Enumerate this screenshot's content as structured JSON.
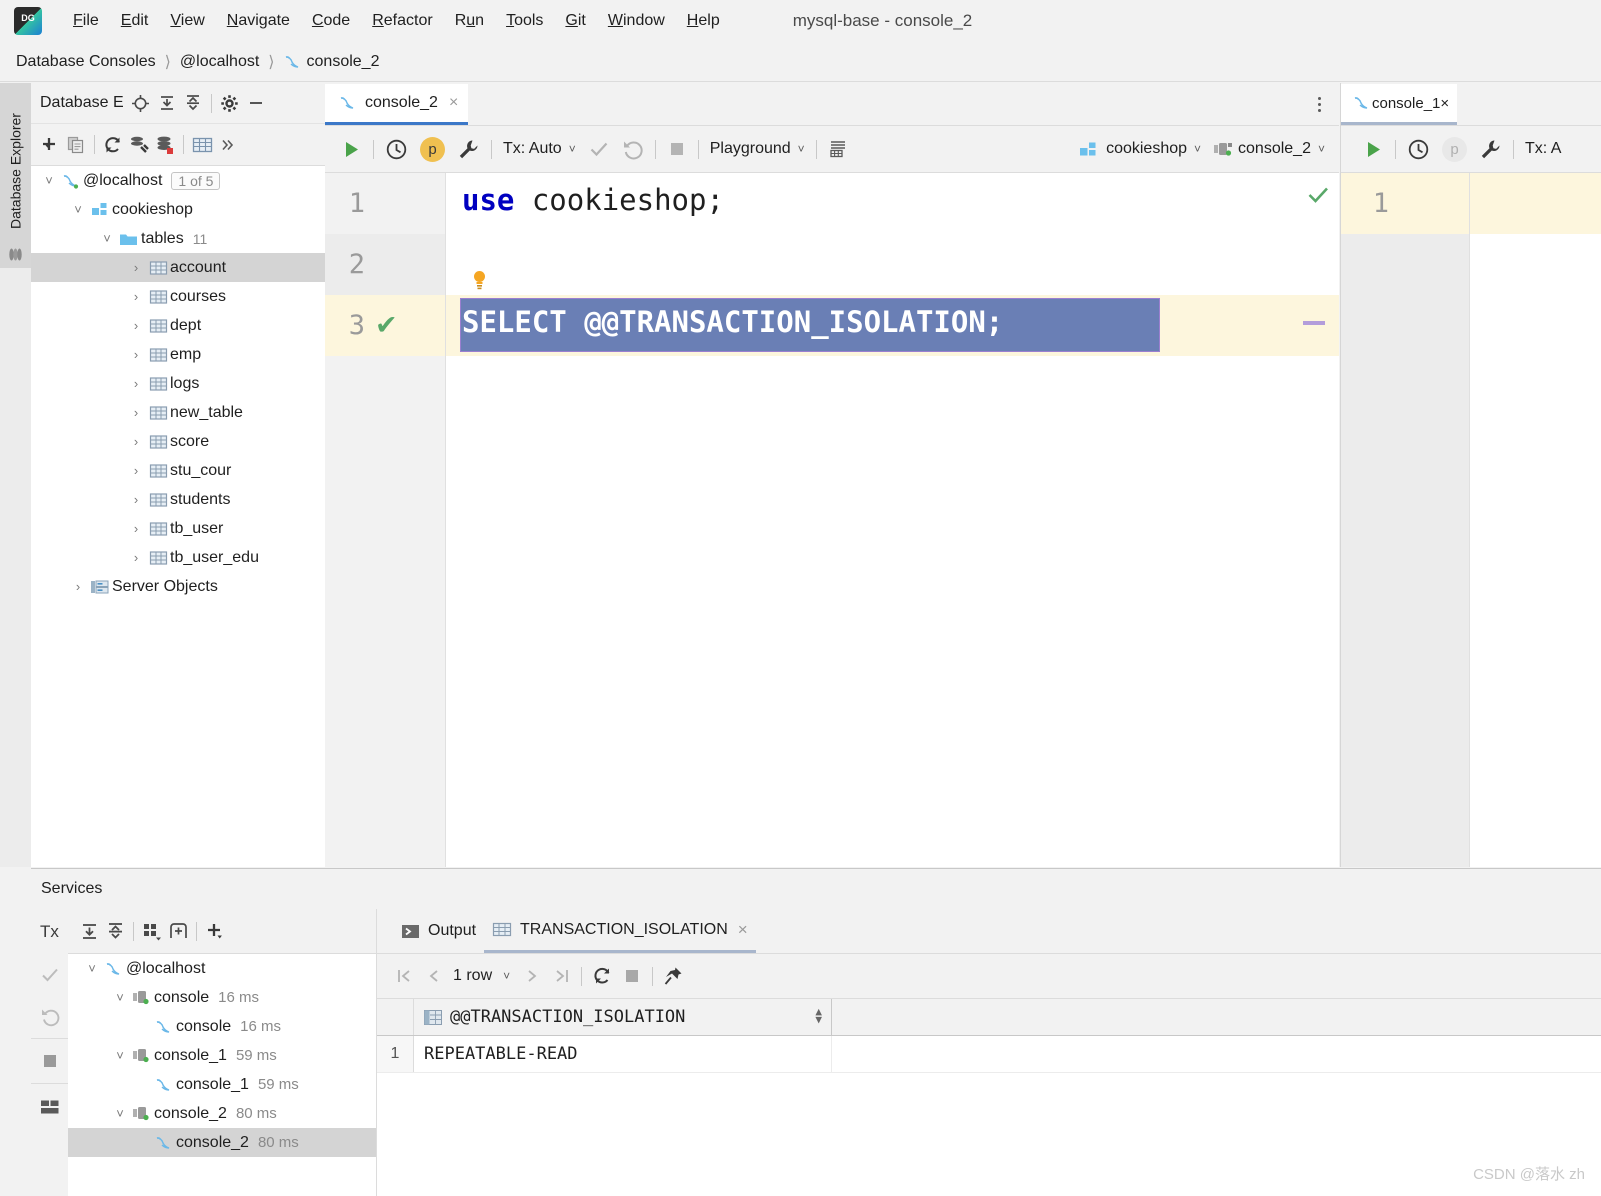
{
  "window": {
    "title": "mysql-base - console_2",
    "logo_label": "DG"
  },
  "menubar": {
    "items": [
      {
        "label": "File",
        "mnemonic": "F"
      },
      {
        "label": "Edit",
        "mnemonic": "E"
      },
      {
        "label": "View",
        "mnemonic": "V"
      },
      {
        "label": "Navigate",
        "mnemonic": "N"
      },
      {
        "label": "Code",
        "mnemonic": "C"
      },
      {
        "label": "Refactor",
        "mnemonic": "R"
      },
      {
        "label": "Run",
        "mnemonic": "u"
      },
      {
        "label": "Tools",
        "mnemonic": "T"
      },
      {
        "label": "Git",
        "mnemonic": "G"
      },
      {
        "label": "Window",
        "mnemonic": "W"
      },
      {
        "label": "Help",
        "mnemonic": "H"
      }
    ]
  },
  "breadcrumb": {
    "items": [
      "Database Consoles",
      "@localhost",
      "console_2"
    ],
    "separator": "〉"
  },
  "tool_strip": {
    "label": "Database Explorer",
    "icon": "database-stack-icon"
  },
  "db_explorer": {
    "title": "Database E",
    "header_icons": [
      "locate-icon",
      "expand-all-icon",
      "collapse-all-icon",
      "gear-icon",
      "minimize-icon"
    ],
    "toolbar_icons": [
      "add-icon",
      "copy-icon",
      "refresh-icon",
      "run-sql-script-icon",
      "data-source-properties-icon",
      "table-editor-icon",
      "more-icon"
    ],
    "tree": [
      {
        "label": "@localhost",
        "badge": "1 of 5",
        "icon": "mysql-icon",
        "depth": 0,
        "expanded": true,
        "selected": false
      },
      {
        "label": "cookieshop",
        "icon": "schema-icon",
        "depth": 1,
        "expanded": true,
        "selected": false
      },
      {
        "label": "tables",
        "count": "11",
        "icon": "folder-icon",
        "depth": 2,
        "expanded": true,
        "selected": false
      },
      {
        "label": "account",
        "icon": "table-icon",
        "depth": 3,
        "expanded": false,
        "selected": true
      },
      {
        "label": "courses",
        "icon": "table-icon",
        "depth": 3,
        "expanded": false,
        "selected": false
      },
      {
        "label": "dept",
        "icon": "table-icon",
        "depth": 3,
        "expanded": false,
        "selected": false
      },
      {
        "label": "emp",
        "icon": "table-icon",
        "depth": 3,
        "expanded": false,
        "selected": false
      },
      {
        "label": "logs",
        "icon": "table-icon",
        "depth": 3,
        "expanded": false,
        "selected": false
      },
      {
        "label": "new_table",
        "icon": "table-icon",
        "depth": 3,
        "expanded": false,
        "selected": false
      },
      {
        "label": "score",
        "icon": "table-icon",
        "depth": 3,
        "expanded": false,
        "selected": false
      },
      {
        "label": "stu_cour",
        "icon": "table-icon",
        "depth": 3,
        "expanded": false,
        "selected": false
      },
      {
        "label": "students",
        "icon": "table-icon",
        "depth": 3,
        "expanded": false,
        "selected": false
      },
      {
        "label": "tb_user",
        "icon": "table-icon",
        "depth": 3,
        "expanded": false,
        "selected": false
      },
      {
        "label": "tb_user_edu",
        "icon": "table-icon",
        "depth": 3,
        "expanded": false,
        "selected": false
      },
      {
        "label": "Server Objects",
        "icon": "server-objects-icon",
        "depth": 1,
        "expanded": false,
        "selected": false
      }
    ]
  },
  "editor": {
    "tab": {
      "label": "console_2",
      "close": "×",
      "icon": "mysql-icon"
    },
    "toolbar": {
      "run_label": "run-icon",
      "history_label": "history-icon",
      "profile_label": "p",
      "wrench_label": "wrench-icon",
      "tx_label": "Tx: Auto",
      "commit_label": "commit-icon",
      "rollback_label": "rollback-icon",
      "stop_label": "stop-icon",
      "schema_mode": "Playground",
      "grid_icon": "sql-dialect-icon",
      "database": "cookieshop",
      "session": "console_2"
    },
    "lines": [
      {
        "num": "1",
        "tokens": [
          {
            "t": "use",
            "k": "kw"
          },
          {
            "t": " cookieshop;",
            "k": "pl"
          }
        ]
      },
      {
        "num": "2",
        "tokens": []
      },
      {
        "num": "3",
        "status": "ok",
        "selected": true,
        "text": "SELECT @@TRANSACTION_ISOLATION;"
      }
    ],
    "inspection_ok": "✔",
    "bulb": "intention-bulb-icon"
  },
  "editor2": {
    "tab": {
      "label": "console_1",
      "close": "×",
      "icon": "mysql-icon"
    },
    "toolbar": {
      "run_label": "run-icon",
      "history_label": "history-icon",
      "profile_label": "p",
      "wrench_label": "wrench-icon",
      "tx_label": "Tx: A"
    },
    "lines": [
      {
        "num": "1"
      }
    ]
  },
  "services": {
    "title": "Services",
    "toolbar_icons": [
      "tx-icon",
      "expand-all-icon",
      "collapse-all-icon",
      "group-icon",
      "add-tab-icon",
      "add-icon"
    ],
    "side_icons": [
      "commit-icon",
      "rollback-icon",
      "stop-icon",
      "layout-icon"
    ],
    "tree": [
      {
        "label": "@localhost",
        "icon": "mysql-icon",
        "depth": 0,
        "expanded": true,
        "selected": false
      },
      {
        "label": "console",
        "time": "16 ms",
        "icon": "session-icon",
        "depth": 1,
        "expanded": true,
        "selected": false
      },
      {
        "label": "console",
        "time": "16 ms",
        "icon": "mysql-icon",
        "depth": 2,
        "selected": false
      },
      {
        "label": "console_1",
        "time": "59 ms",
        "icon": "session-icon",
        "depth": 1,
        "expanded": true,
        "selected": false
      },
      {
        "label": "console_1",
        "time": "59 ms",
        "icon": "mysql-icon",
        "depth": 2,
        "selected": false
      },
      {
        "label": "console_2",
        "time": "80 ms",
        "icon": "session-icon",
        "depth": 1,
        "expanded": true,
        "selected": false
      },
      {
        "label": "console_2",
        "time": "80 ms",
        "icon": "mysql-icon",
        "depth": 2,
        "selected": true
      }
    ],
    "result_tabs": [
      {
        "label": "Output",
        "icon": "output-icon",
        "active": false,
        "closable": false
      },
      {
        "label": "TRANSACTION_ISOLATION",
        "icon": "table-icon",
        "active": true,
        "closable": true
      }
    ],
    "grid_toolbar": {
      "first_page": "first-page-icon",
      "prev_page": "prev-page-icon",
      "row_count": "1 row",
      "next_page": "next-page-icon",
      "last_page": "last-page-icon",
      "reload": "reload-icon",
      "stop": "stop-icon",
      "pin": "pin-icon"
    },
    "grid": {
      "columns": [
        "@@TRANSACTION_ISOLATION"
      ],
      "rows": [
        {
          "num": "1",
          "cells": [
            "REPEATABLE-READ"
          ]
        }
      ]
    }
  },
  "watermark": "CSDN @落水 zh",
  "colors": {
    "accent_blue": "#3c78c8",
    "selection": "#6a7fb5",
    "keyword": "#0000c0",
    "ok_green": "#59a869",
    "row_highlight": "#fdf6dd",
    "panel_bg": "#f2f2f2"
  }
}
